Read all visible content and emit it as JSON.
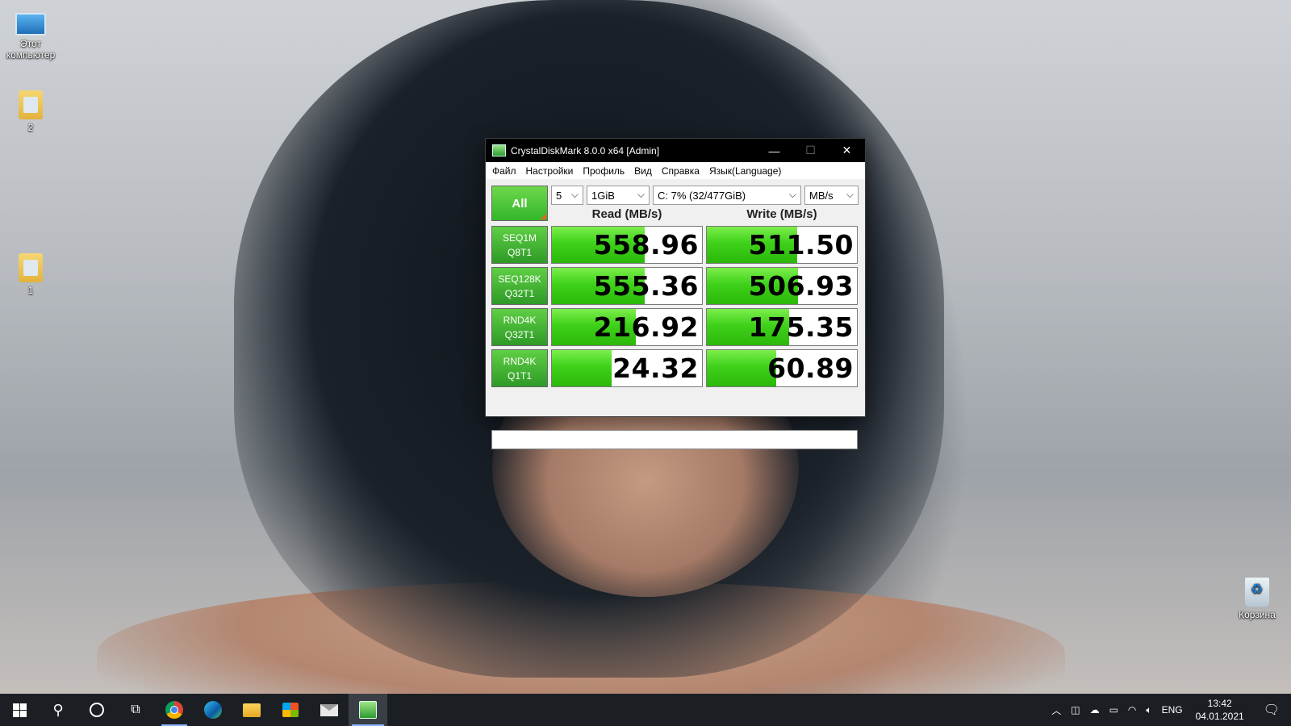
{
  "desktop": {
    "icons": [
      {
        "label": "Этот компьютер",
        "icon": "computer-icon"
      },
      {
        "label": "2",
        "icon": "folder-icon"
      },
      {
        "label": "1",
        "icon": "folder-icon"
      },
      {
        "label": "Корзина",
        "icon": "recycle-bin-icon"
      }
    ]
  },
  "window": {
    "title": "CrystalDiskMark 8.0.0 x64 [Admin]",
    "controls": {
      "minimize": "—",
      "maximize": "☐",
      "close": "✕"
    },
    "menu": [
      "Файл",
      "Настройки",
      "Профиль",
      "Вид",
      "Справка",
      "Язык(Language)"
    ],
    "all_button": "All",
    "count": "5",
    "size": "1GiB",
    "drive": "C: 7% (32/477GiB)",
    "unit": "MB/s",
    "read_header": "Read (MB/s)",
    "write_header": "Write (MB/s)",
    "accent_green": "#3fd11a",
    "tests": [
      {
        "line1": "SEQ1M",
        "line2": "Q8T1",
        "read": "558.96",
        "write": "511.50",
        "read_fill": 0.62,
        "write_fill": 0.6
      },
      {
        "line1": "SEQ128K",
        "line2": "Q32T1",
        "read": "555.36",
        "write": "506.93",
        "read_fill": 0.62,
        "write_fill": 0.61
      },
      {
        "line1": "RND4K",
        "line2": "Q32T1",
        "read": "216.92",
        "write": "175.35",
        "read_fill": 0.56,
        "write_fill": 0.55
      },
      {
        "line1": "RND4K",
        "line2": "Q1T1",
        "read": "24.32",
        "write": "60.89",
        "read_fill": 0.4,
        "write_fill": 0.46
      }
    ],
    "status": ""
  },
  "taskbar": {
    "apps": [
      "start",
      "search",
      "cortana",
      "task-view",
      "chrome",
      "edge",
      "file-explorer",
      "store",
      "mail",
      "crystaldiskmark"
    ],
    "tray": {
      "language": "ENG",
      "time": "13:42",
      "date": "04.01.2021"
    }
  }
}
